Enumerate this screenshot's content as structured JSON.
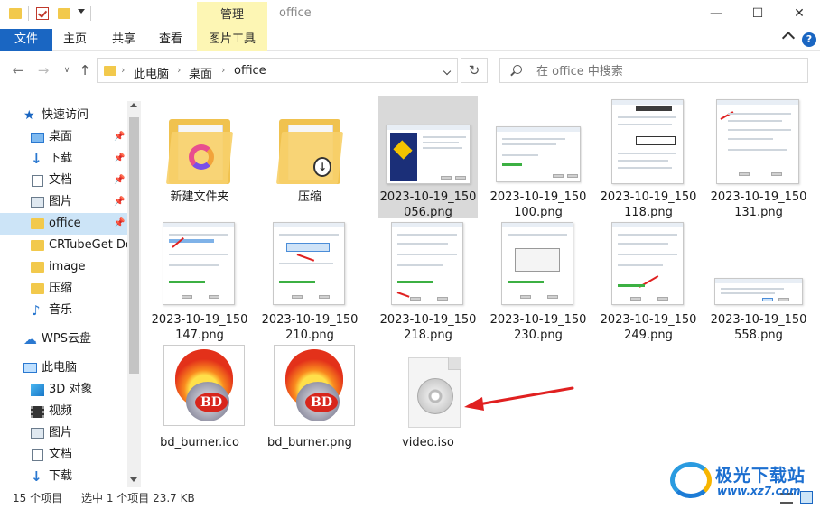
{
  "titlebar": {
    "manage_tab": "管理",
    "window_title": "office",
    "minimize": "—",
    "maximize": "☐",
    "close": "✕"
  },
  "ribbon": {
    "tabs": [
      "文件",
      "主页",
      "共享",
      "查看",
      "图片工具"
    ],
    "help": "?"
  },
  "nav": {
    "back": "←",
    "forward": "→",
    "recent": "∨",
    "up": "↑",
    "refresh": "↻",
    "breadcrumb": [
      "此电脑",
      "桌面",
      "office"
    ],
    "separator": "›",
    "search_placeholder": "在 office 中搜索"
  },
  "sidebar": {
    "items": [
      {
        "label": "快速访问",
        "icon": "star-icon"
      },
      {
        "label": "桌面",
        "icon": "desktop-icon",
        "pinned": true
      },
      {
        "label": "下载",
        "icon": "download-icon",
        "pinned": true
      },
      {
        "label": "文档",
        "icon": "document-icon",
        "pinned": true
      },
      {
        "label": "图片",
        "icon": "picture-icon",
        "pinned": true
      },
      {
        "label": "office",
        "icon": "folder-icon",
        "pinned": true,
        "selected": true
      },
      {
        "label": "CRTubeGet Do",
        "icon": "folder-icon"
      },
      {
        "label": "image",
        "icon": "folder-icon"
      },
      {
        "label": "压缩",
        "icon": "folder-icon"
      },
      {
        "label": "音乐",
        "icon": "music-icon"
      },
      {
        "label": "WPS云盘",
        "icon": "cloud-icon"
      },
      {
        "label": "此电脑",
        "icon": "computer-icon"
      },
      {
        "label": "3D 对象",
        "icon": "3d-objects-icon"
      },
      {
        "label": "视频",
        "icon": "video-icon"
      },
      {
        "label": "图片",
        "icon": "picture-icon"
      },
      {
        "label": "文档",
        "icon": "document-icon"
      },
      {
        "label": "下载",
        "icon": "download-icon"
      }
    ],
    "pin_glyph": "📌"
  },
  "files": [
    {
      "name": "新建文件夹",
      "kind": "folder"
    },
    {
      "name": "压缩",
      "kind": "folder-zip"
    },
    {
      "name": "2023-10-19_150056.png",
      "kind": "png",
      "selected": true
    },
    {
      "name": "2023-10-19_150100.png",
      "kind": "png"
    },
    {
      "name": "2023-10-19_150118.png",
      "kind": "png"
    },
    {
      "name": "2023-10-19_150131.png",
      "kind": "png"
    },
    {
      "name": "2023-10-19_150147.png",
      "kind": "png"
    },
    {
      "name": "2023-10-19_150210.png",
      "kind": "png"
    },
    {
      "name": "2023-10-19_150218.png",
      "kind": "png"
    },
    {
      "name": "2023-10-19_150230.png",
      "kind": "png"
    },
    {
      "name": "2023-10-19_150249.png",
      "kind": "png"
    },
    {
      "name": "2023-10-19_150558.png",
      "kind": "png"
    },
    {
      "name": "bd_burner.ico",
      "kind": "ico"
    },
    {
      "name": "bd_burner.png",
      "kind": "ico"
    },
    {
      "name": "video.iso",
      "kind": "iso"
    }
  ],
  "bd_badge": "BD",
  "status": {
    "count": "15 个项目",
    "selection": "选中 1 个项目  23.7 KB"
  },
  "watermark": {
    "title": "极光下载站",
    "url": "www.xz7.com"
  },
  "colors": {
    "accent": "#1a66c2",
    "ribbon_highlight": "#fdf6b4",
    "selection": "#cce4f7",
    "arrow": "#e02020"
  }
}
